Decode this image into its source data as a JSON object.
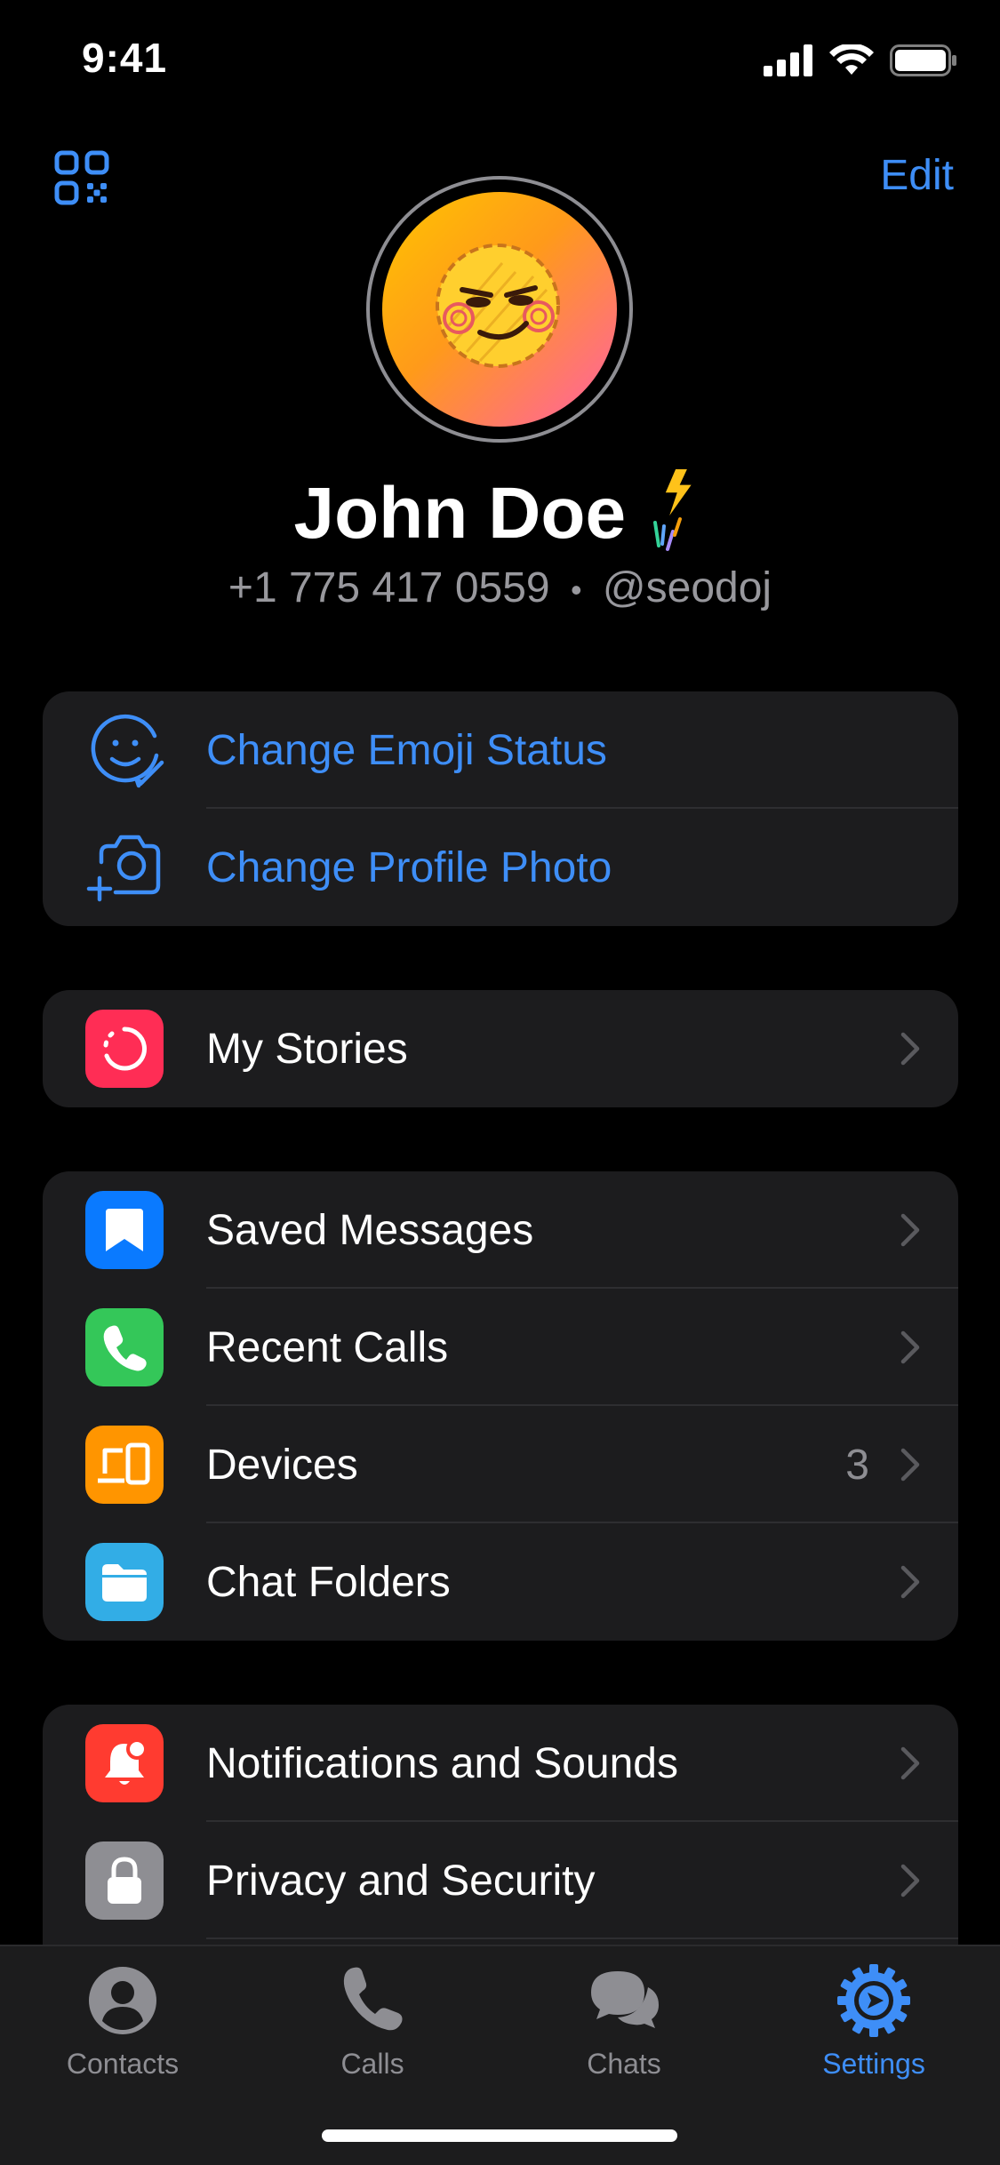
{
  "status_bar": {
    "time": "9:41"
  },
  "header": {
    "edit_label": "Edit"
  },
  "profile": {
    "name": "John Doe",
    "phone": "+1 775 417 0559",
    "separator": "•",
    "username": "@seodoj"
  },
  "profile_actions": [
    {
      "label": "Change Emoji Status",
      "icon": "emoji-smile-icon"
    },
    {
      "label": "Change Profile Photo",
      "icon": "camera-add-icon"
    }
  ],
  "stories": {
    "label": "My Stories",
    "icon": "stories-icon",
    "color": "#ff2d55"
  },
  "main_items": [
    {
      "label": "Saved Messages",
      "icon": "bookmark-icon",
      "color": "#0a7aff"
    },
    {
      "label": "Recent Calls",
      "icon": "phone-icon",
      "color": "#34c759"
    },
    {
      "label": "Devices",
      "icon": "devices-icon",
      "color": "#ff9500",
      "value": "3"
    },
    {
      "label": "Chat Folders",
      "icon": "folder-icon",
      "color": "#32ade6"
    }
  ],
  "settings_items": [
    {
      "label": "Notifications and Sounds",
      "icon": "bell-icon",
      "color": "#ff3b30"
    },
    {
      "label": "Privacy and Security",
      "icon": "lock-icon",
      "color": "#8e8e93"
    }
  ],
  "tabs": [
    {
      "label": "Contacts",
      "icon": "person-icon",
      "active": false
    },
    {
      "label": "Calls",
      "icon": "phone-icon",
      "active": false
    },
    {
      "label": "Chats",
      "icon": "chat-bubbles-icon",
      "active": false
    },
    {
      "label": "Settings",
      "icon": "gear-icon",
      "active": true
    }
  ],
  "colors": {
    "accent": "#3e8ef7",
    "background": "#000000",
    "group": "#1c1c1e"
  }
}
